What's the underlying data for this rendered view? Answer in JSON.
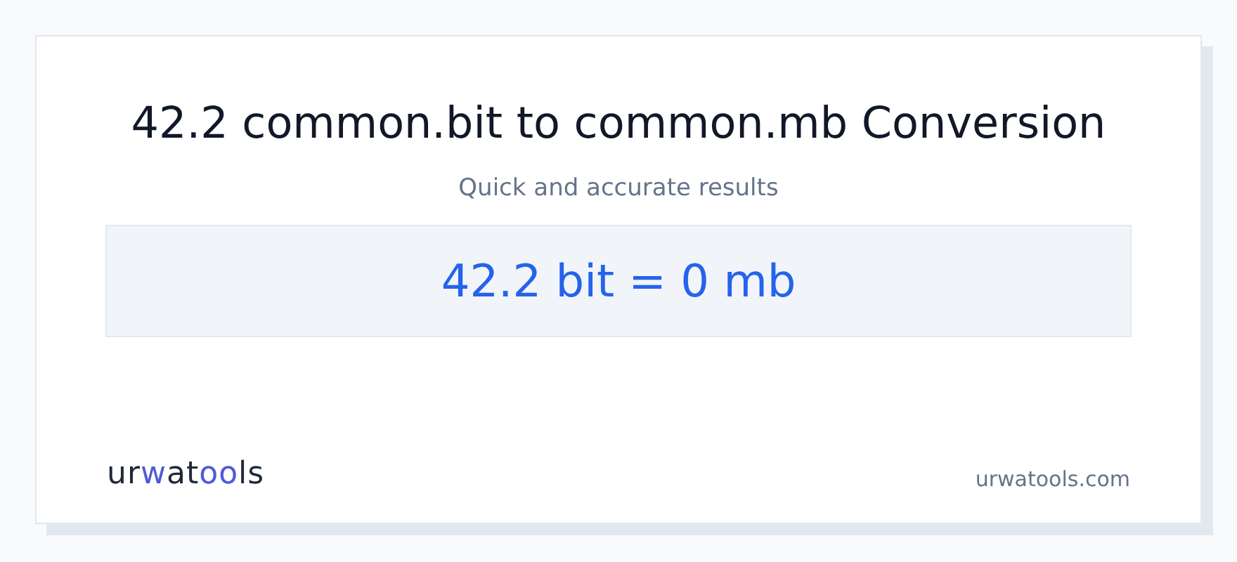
{
  "title": "42.2 common.bit to common.mb Conversion",
  "subtitle": "Quick and accurate results",
  "result": "42.2 bit = 0 mb",
  "logo": [
    {
      "text": "ur",
      "accent": false
    },
    {
      "text": "w",
      "accent": true
    },
    {
      "text": "at",
      "accent": false
    },
    {
      "text": "oo",
      "accent": true
    },
    {
      "text": "ls",
      "accent": false
    }
  ],
  "site": "urwatools.com"
}
